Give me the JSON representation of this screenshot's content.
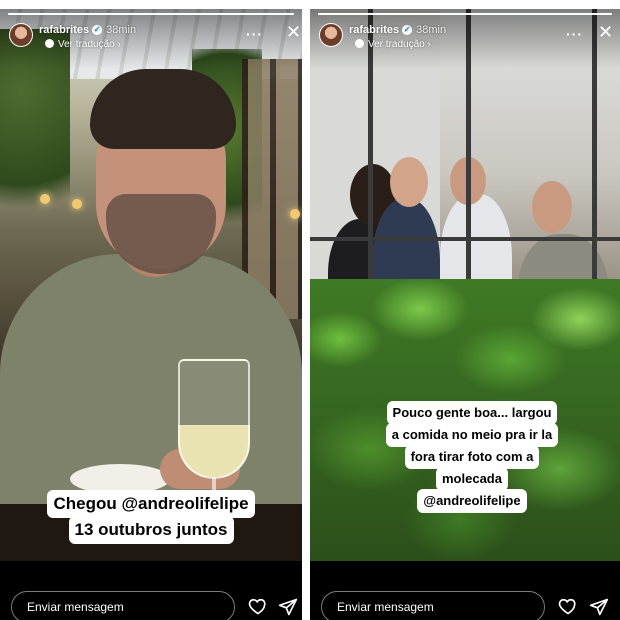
{
  "stories": [
    {
      "username": "rafabrites",
      "time": "38min",
      "translate": "Ver tradução",
      "progress": 1.0,
      "caption": [
        "Chegou @andreolifelipe",
        "13 outubros juntos"
      ],
      "message_placeholder": "Enviar mensagem"
    },
    {
      "username": "rafabrites",
      "time": "38min",
      "translate": "Ver tradução",
      "progress": 1.0,
      "caption": [
        "Pouco gente boa... largou",
        "a comida no meio pra ir la",
        "fora tirar foto com a",
        "molecada",
        "@andreolifelipe"
      ],
      "message_placeholder": "Enviar mensagem"
    }
  ],
  "icons": {
    "verified": "verified-badge-icon",
    "translate": "globe-icon",
    "more": "more-dots-icon",
    "close": "close-icon",
    "like": "heart-icon",
    "share": "send-icon"
  },
  "colors": {
    "verified": "#0095f6",
    "background": "#000000"
  }
}
